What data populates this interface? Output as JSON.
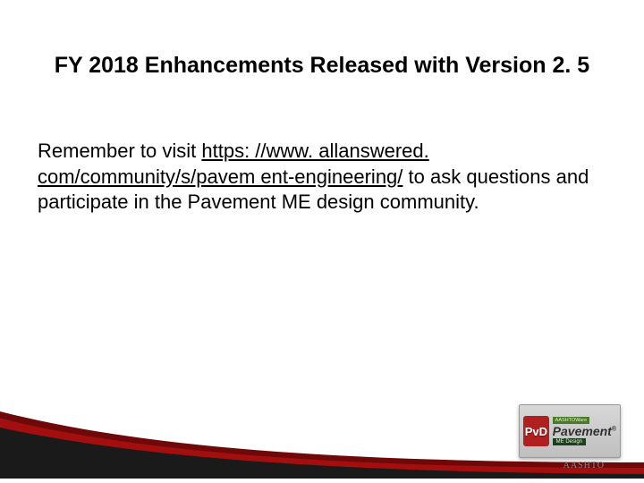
{
  "title": "FY 2018 Enhancements Released with Version 2. 5",
  "body": {
    "text_before_link": "Remember to visit ",
    "link_text": "https: //www. allanswered. com/community/s/pavem ent-engineering/",
    "link_href": "https://www.allanswered.com/community/s/pavement-engineering/",
    "text_after_link": " to ask questions and participate in the Pavement ME design community."
  },
  "logo": {
    "pvd": "PvD",
    "ware": "AASHTOWare",
    "pavement": "Pavement",
    "reg": "®",
    "sub": "ME Design"
  },
  "aashto": "AASHTO",
  "colors": {
    "red_a": "#a30f0e",
    "red_b": "#6f0808",
    "black": "#1a1a1a"
  }
}
